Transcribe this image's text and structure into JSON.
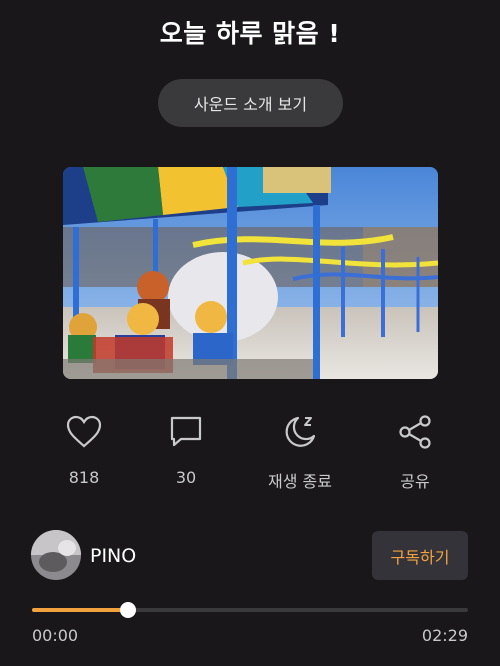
{
  "header": {
    "title": "오늘 하루 맑음 !"
  },
  "sound_intro_button": "사운드 소개 보기",
  "actions": [
    {
      "icon": "heart-icon",
      "label": "818"
    },
    {
      "icon": "comment-icon",
      "label": "30"
    },
    {
      "icon": "sleep-timer-icon",
      "label": "재생 종료"
    },
    {
      "icon": "share-icon",
      "label": "공유"
    }
  ],
  "creator": {
    "name": "PINO",
    "subscribe_label": "구독하기"
  },
  "player": {
    "current_time": "00:00",
    "total_time": "02:29",
    "progress": 0.22
  },
  "colors": {
    "accent": "#f3a33e",
    "background": "#19171a",
    "button_bg": "#3a393c"
  }
}
